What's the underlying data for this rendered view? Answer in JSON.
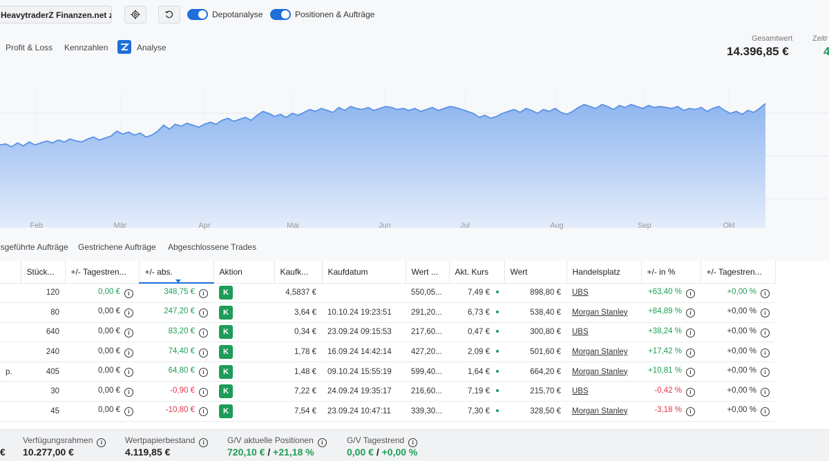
{
  "header": {
    "account": "HeavytraderZ Finanzen.net zero",
    "toggles": [
      {
        "label": "Depotanalyse",
        "on": true
      },
      {
        "label": "Positionen & Aufträge",
        "on": true
      }
    ]
  },
  "tabs": [
    "Profit & Loss",
    "Kennzahlen",
    "Analyse"
  ],
  "kpis": {
    "gesamtwert_label": "Gesamtwert",
    "gesamtwert_value": "14.396,85 €",
    "zeit_label": "Zeitr",
    "zeit_value": "4"
  },
  "chart_data": {
    "type": "area",
    "xlabels": [
      "Feb",
      "Mär",
      "Apr",
      "Mai",
      "Jun",
      "Jul",
      "Aug",
      "Sep",
      "Okt"
    ],
    "series": [
      {
        "values": [
          0.58,
          0.59,
          0.56,
          0.6,
          0.57,
          0.61,
          0.58,
          0.6,
          0.62,
          0.6,
          0.63,
          0.61,
          0.64,
          0.62,
          0.61,
          0.64,
          0.66,
          0.63,
          0.65,
          0.67,
          0.72,
          0.69,
          0.71,
          0.68,
          0.7,
          0.66,
          0.68,
          0.72,
          0.78,
          0.74,
          0.79,
          0.77,
          0.8,
          0.78,
          0.76,
          0.79,
          0.81,
          0.79,
          0.83,
          0.85,
          0.82,
          0.84,
          0.86,
          0.83,
          0.88,
          0.92,
          0.9,
          0.87,
          0.89,
          0.86,
          0.9,
          0.88,
          0.91,
          0.94,
          0.92,
          0.95,
          0.93,
          0.91,
          0.96,
          0.93,
          0.97,
          0.95,
          0.94,
          0.96,
          0.93,
          0.95,
          0.97,
          0.96,
          0.94,
          0.95,
          0.93,
          0.95,
          0.92,
          0.94,
          0.96,
          0.93,
          0.95,
          0.97,
          0.96,
          0.94,
          0.92,
          0.9,
          0.86,
          0.88,
          0.85,
          0.87,
          0.9,
          0.92,
          0.94,
          0.91,
          0.95,
          0.93,
          0.9,
          0.94,
          0.92,
          0.95,
          0.91,
          0.89,
          0.92,
          0.96,
          0.99,
          0.97,
          0.95,
          0.99,
          0.97,
          0.94,
          0.98,
          0.96,
          0.99,
          0.97,
          0.95,
          0.98,
          0.96,
          0.97,
          0.96,
          0.95,
          0.97,
          0.93,
          0.95,
          0.94,
          0.96,
          0.92,
          0.95,
          0.97,
          0.93,
          0.9,
          0.92,
          0.89,
          0.93,
          0.91,
          0.95,
          1.0
        ]
      }
    ]
  },
  "subtabs": [
    "Ausgeführte Aufträge",
    "Gestrichene Aufträge",
    "Abgeschlossene Trades"
  ],
  "table": {
    "columns": [
      "",
      "Stück...",
      "+/- Tagestren...",
      "+/- abs.",
      "Aktion",
      "Kaufk...",
      "Kaufdatum",
      "Wert ...",
      "Akt. Kurs",
      "Wert",
      "Handelsplatz",
      "+/- in %",
      "+/- Tagestren..."
    ],
    "rows": [
      {
        "name": "",
        "qty": "120",
        "day": "0,00 €",
        "day_cls": "pos",
        "abs": "348,75 €",
        "abs_cls": "pos",
        "action": "K",
        "buy": "4,5837 €",
        "date": "",
        "val1": "550,05...",
        "price": "7,49 €",
        "val": "898,80 €",
        "venue": "UBS",
        "pct": "+63,40 %",
        "pct_cls": "pos",
        "dpct": "+0,00 %",
        "dpct_cls": "pos"
      },
      {
        "name": "",
        "qty": "80",
        "day": "0,00 €",
        "day_cls": "",
        "abs": "247,20 €",
        "abs_cls": "pos",
        "action": "K",
        "buy": "3,64 €",
        "date": "10.10.24 19:23:51",
        "val1": "291,20...",
        "price": "6,73 €",
        "val": "538,40 €",
        "venue": "Morgan Stanley",
        "pct": "+84,89 %",
        "pct_cls": "pos",
        "dpct": "+0,00 %",
        "dpct_cls": ""
      },
      {
        "name": "",
        "qty": "640",
        "day": "0,00 €",
        "day_cls": "",
        "abs": "83,20 €",
        "abs_cls": "pos",
        "action": "K",
        "buy": "0,34 €",
        "date": "23.09.24 09:15:53",
        "val1": "217,60...",
        "price": "0,47 €",
        "val": "300,80 €",
        "venue": "UBS",
        "pct": "+38,24 %",
        "pct_cls": "pos",
        "dpct": "+0,00 %",
        "dpct_cls": ""
      },
      {
        "name": "",
        "qty": "240",
        "day": "0,00 €",
        "day_cls": "",
        "abs": "74,40 €",
        "abs_cls": "pos",
        "action": "K",
        "buy": "1,78 €",
        "date": "16.09.24 14:42:14",
        "val1": "427,20...",
        "price": "2,09 €",
        "val": "501,60 €",
        "venue": "Morgan Stanley",
        "pct": "+17,42 %",
        "pct_cls": "pos",
        "dpct": "+0,00 %",
        "dpct_cls": ""
      },
      {
        "name": "p.",
        "qty": "405",
        "day": "0,00 €",
        "day_cls": "",
        "abs": "64,80 €",
        "abs_cls": "pos",
        "action": "K",
        "buy": "1,48 €",
        "date": "09.10.24 15:55:19",
        "val1": "599,40...",
        "price": "1,64 €",
        "val": "664,20 €",
        "venue": "Morgan Stanley",
        "pct": "+10,81 %",
        "pct_cls": "pos",
        "dpct": "+0,00 %",
        "dpct_cls": ""
      },
      {
        "name": "",
        "qty": "30",
        "day": "0,00 €",
        "day_cls": "",
        "abs": "-0,90 €",
        "abs_cls": "neg",
        "action": "K",
        "buy": "7,22 €",
        "date": "24.09.24 19:35:17",
        "val1": "216,60...",
        "price": "7,19 €",
        "val": "215,70 €",
        "venue": "UBS",
        "pct": "-0,42 %",
        "pct_cls": "neg",
        "dpct": "+0,00 %",
        "dpct_cls": ""
      },
      {
        "name": "",
        "qty": "45",
        "day": "0,00 €",
        "day_cls": "",
        "abs": "-10,80 €",
        "abs_cls": "neg",
        "action": "K",
        "buy": "7,54 €",
        "date": "23.09.24 10:47:11",
        "val1": "339,30...",
        "price": "7,30 €",
        "val": "328,50 €",
        "venue": "Morgan Stanley",
        "pct": "-3,18 %",
        "pct_cls": "neg",
        "dpct": "+0,00 %",
        "dpct_cls": ""
      }
    ]
  },
  "footer": {
    "first_value": "€",
    "verfuegung_label": "Verfügungsrahmen",
    "verfuegung_value": "10.277,00 €",
    "bestand_label": "Wertpapierbestand",
    "bestand_value": "4.119,85 €",
    "gv_label": "G/V aktuelle Positionen",
    "gv_value": "720,10 €",
    "gv_pct": "+21,18 %",
    "trend_label": "G/V Tagestrend",
    "trend_value": "0,00 €",
    "trend_pct": "+0,00 %"
  },
  "colors": {
    "accent": "#1e6fd9",
    "positive": "#1e9e55",
    "negative": "#e0364a",
    "area_fill": "#9fc2f2",
    "line": "#5a92e6"
  }
}
